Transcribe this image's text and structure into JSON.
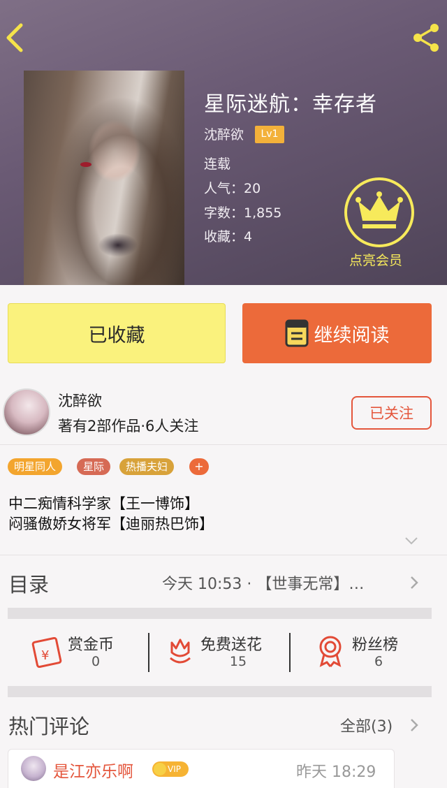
{
  "header": {
    "title": "星际迷航：幸存者",
    "author": "沈醉欲",
    "level": "Lv1",
    "status": "连载",
    "popularity": "人气：20",
    "word_count": "字数：1,855",
    "favorites": "收藏：4",
    "vip_label": "点亮会员",
    "icons": {
      "back": "back-chevron-icon",
      "share": "share-icon",
      "crown": "crown-icon"
    }
  },
  "actions": {
    "collected_label": "已收藏",
    "read_label": "继续阅读",
    "book_icon": "book-icon"
  },
  "author_row": {
    "name": "沈醉欲",
    "stats": "著有2部作品·6人关注",
    "follow_label": "已关注"
  },
  "tags": [
    {
      "label": "明星同人",
      "color": "#f3a52e"
    },
    {
      "label": "星际",
      "color": "#d66a55"
    },
    {
      "label": "热播夫妇",
      "color": "#d8a23a"
    }
  ],
  "tag_add": "+",
  "intro": [
    "中二痴情科学家【王一博饰】",
    "闷骚傲娇女将军【迪丽热巴饰】"
  ],
  "catalog": {
    "title": "目录",
    "latest": "今天 10:53 · 【世事无常】…"
  },
  "stats": [
    {
      "label": "赏金币",
      "value": "0",
      "icon": "red-envelope-icon"
    },
    {
      "label": "免费送花",
      "value": "15",
      "icon": "flower-icon"
    },
    {
      "label": "粉丝榜",
      "value": "6",
      "icon": "ribbon-medal-icon"
    }
  ],
  "comments": {
    "title": "热门评论",
    "all_label": "全部(3)",
    "first": {
      "user": "是江亦乐啊",
      "badge": "VIP",
      "time": "昨天 18:29"
    }
  },
  "colors": {
    "accent": "#ec6a3a",
    "yellow_button": "#faf27d",
    "crown": "#f7ea5b",
    "follow": "#e4563c"
  }
}
